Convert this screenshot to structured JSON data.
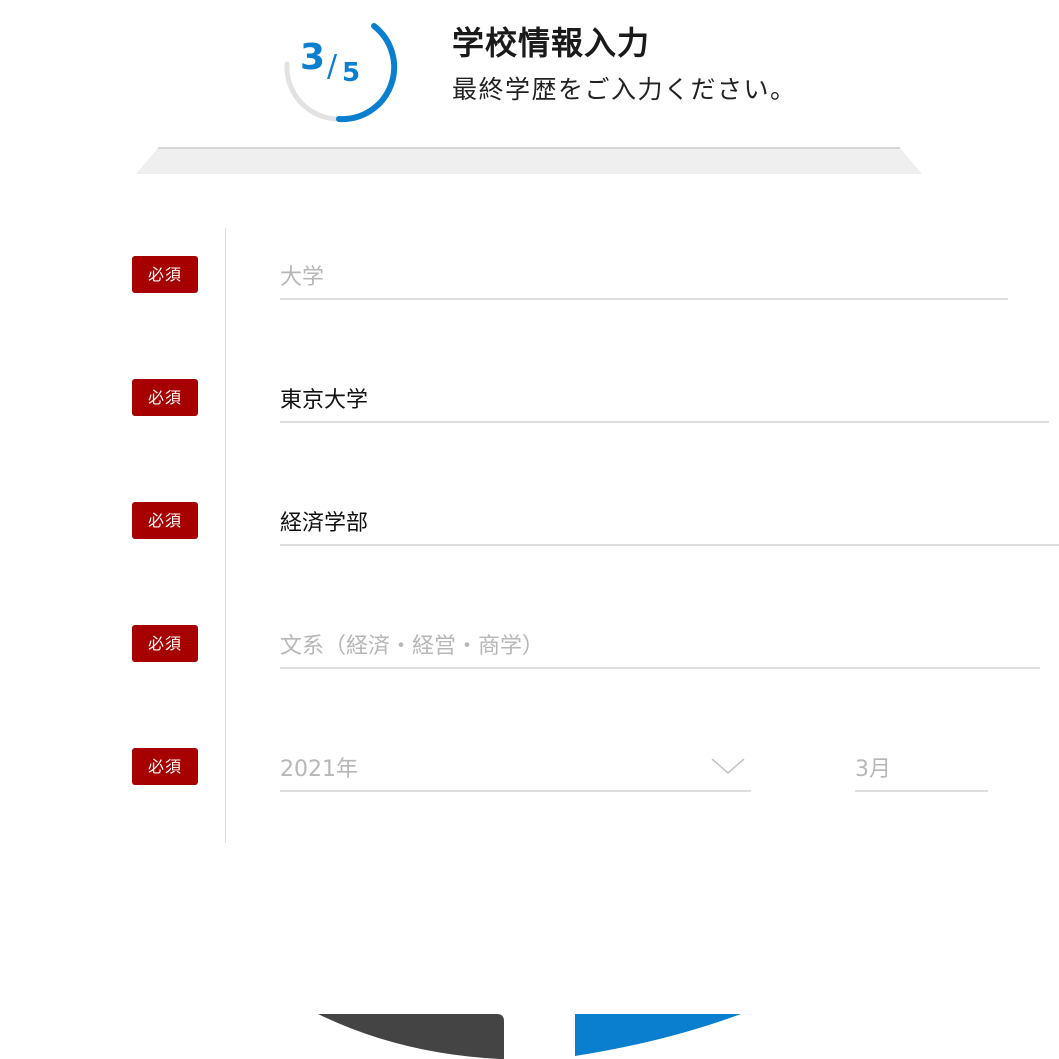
{
  "colors": {
    "accent": "#0a7fcf",
    "required": "#a60000",
    "field_line": "#dedede",
    "placeholder": "#b7b7b7",
    "back_button": "#444444"
  },
  "progress": {
    "current": "3",
    "separator": "/",
    "total": "5",
    "fraction": 0.6
  },
  "header": {
    "title": "学校情報入力",
    "subtitle": "最終学歴をご入力ください。"
  },
  "required_label": "必須",
  "fields": {
    "school_type": {
      "placeholder": "大学",
      "value": ""
    },
    "school_name": {
      "value": "東京大学"
    },
    "faculty": {
      "value": "経済学部"
    },
    "field_of_study": {
      "placeholder": "文系（経済・経営・商学）",
      "value": ""
    },
    "graduation_year": {
      "placeholder": "2021年",
      "icon": "chevron-down-icon"
    },
    "graduation_month": {
      "placeholder": "3月"
    }
  },
  "buttons": {
    "back": {
      "label": ""
    },
    "next": {
      "label": ""
    }
  }
}
